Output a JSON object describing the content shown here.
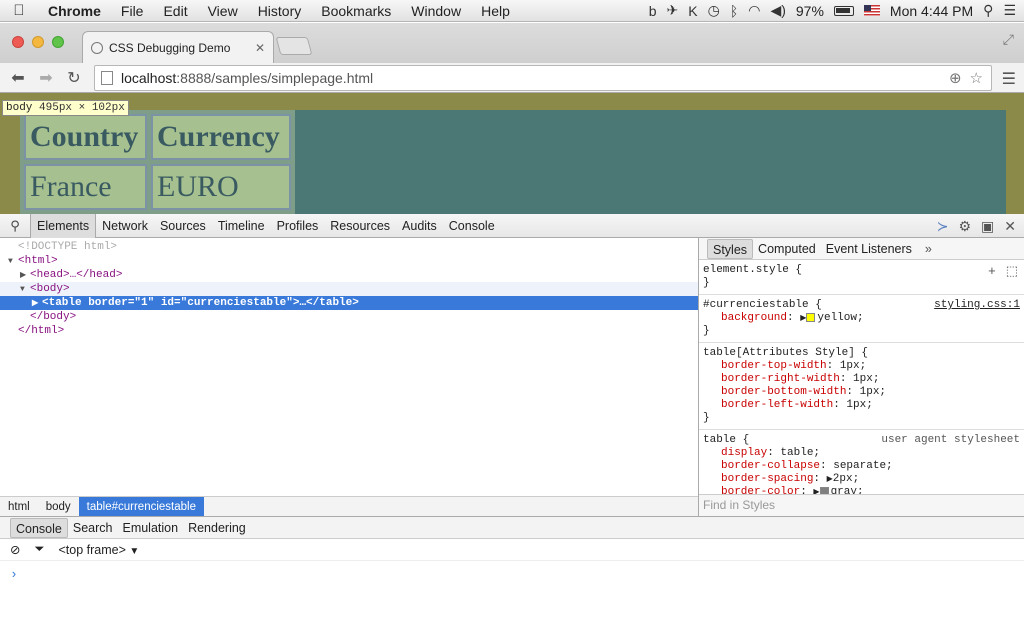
{
  "menubar": {
    "app_name": "Chrome",
    "items": [
      "File",
      "Edit",
      "View",
      "History",
      "Bookmarks",
      "Window",
      "Help"
    ],
    "battery": "97%",
    "clock": "Mon 4:44 PM"
  },
  "browser": {
    "tab_title": "CSS Debugging Demo",
    "url_host": "localhost",
    "url_path": ":8888/samples/simplepage.html"
  },
  "page": {
    "tooltip_tag": "body",
    "tooltip_size": "495px × 102px",
    "table": {
      "headers": [
        "Country",
        "Currency"
      ],
      "rows": [
        [
          "France",
          "EURO"
        ]
      ]
    },
    "colors": {
      "body_margin": "#8c8a49",
      "body_content": "#4b7774",
      "table_bg": "#a6c18f"
    }
  },
  "devtools": {
    "tabs": [
      "Elements",
      "Network",
      "Sources",
      "Timeline",
      "Profiles",
      "Resources",
      "Audits",
      "Console"
    ],
    "selected_tab": "Elements",
    "dom": {
      "doctype": "<!DOCTYPE html>",
      "html_open": "<html>",
      "head": "<head>…</head>",
      "body_open": "<body>",
      "table": "<table border=\"1\" id=\"currenciestable\">…</table>",
      "body_close": "</body>",
      "html_close": "</html>"
    },
    "breadcrumbs": [
      "html",
      "body",
      "table#currenciestable"
    ],
    "styles_tabs": [
      "Styles",
      "Computed",
      "Event Listeners"
    ],
    "styles_more": "»",
    "rules": {
      "element_style": "element.style {",
      "r1_selector": "#currenciestable {",
      "r1_source": "styling.css:1",
      "r1_prop": "background",
      "r1_value": "yellow;",
      "r2_selector": "table[Attributes Style] {",
      "r2_props": [
        {
          "name": "border-top-width",
          "value": "1px;"
        },
        {
          "name": "border-right-width",
          "value": "1px;"
        },
        {
          "name": "border-bottom-width",
          "value": "1px;"
        },
        {
          "name": "border-left-width",
          "value": "1px;"
        }
      ],
      "r3_selector": "table {",
      "r3_source": "user agent stylesheet",
      "r3_props": [
        {
          "name": "display",
          "value": "table;"
        },
        {
          "name": "border-collapse",
          "value": "separate;"
        },
        {
          "name": "border-spacing",
          "value": "2px;"
        },
        {
          "name": "border-color",
          "value": "gray;"
        }
      ],
      "close_brace": "}"
    },
    "find_placeholder": "Find in Styles",
    "drawer_tabs": [
      "Console",
      "Search",
      "Emulation",
      "Rendering"
    ],
    "frame_select": "<top frame>"
  }
}
